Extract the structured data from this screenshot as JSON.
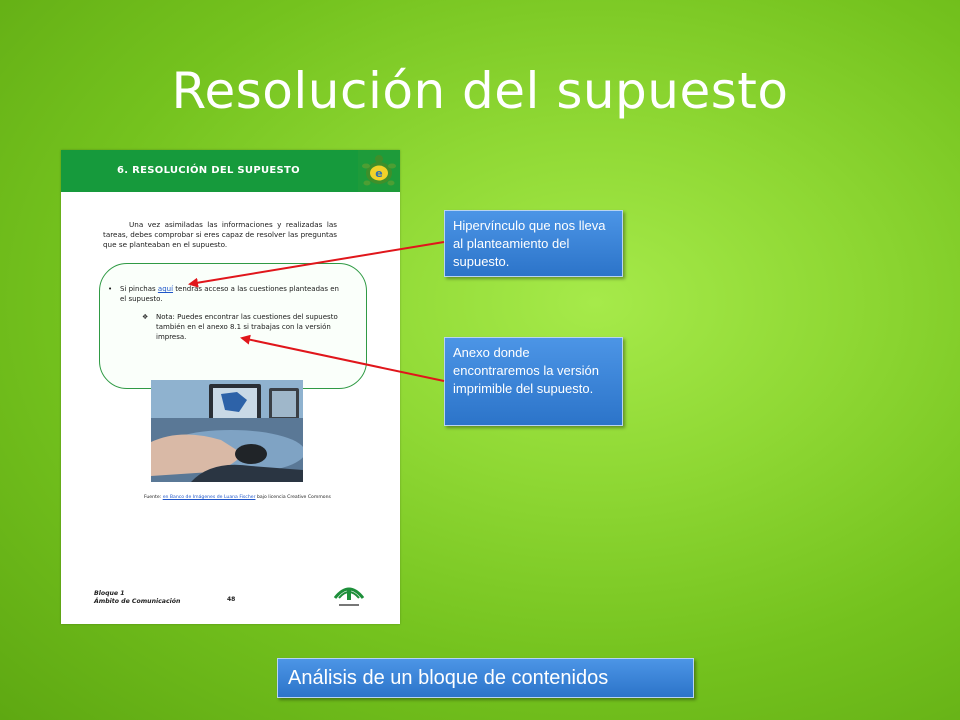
{
  "slide": {
    "title": "Resolución del supuesto",
    "footer_label": "Análisis de un bloque de contenidos"
  },
  "document": {
    "header_title": "6. RESOLUCIÓN DEL SUPUESTO",
    "intro_text": "Una vez asimiladas las informaciones y realizadas las tareas, debes comprobar si eres capaz de resolver las preguntas que se planteaban en el supuesto.",
    "bullet_prefix": "Si pinchas",
    "bullet_link": "aquí",
    "bullet_suffix": "tendrás acceso a las cuestiones planteadas en el supuesto.",
    "note_text": "Nota: Puedes encontrar las cuestiones del supuesto también en el anexo 8.1 si trabajas con la versión impresa.",
    "caption_prefix": "Fuente:",
    "caption_link": "en Banco de Imágenes de Luana Fischer",
    "caption_suffix": "bajo licencia Creative Commons",
    "footer_line1": "Bloque 1",
    "footer_line2": "Ámbito de Comunicación",
    "page_number": "48"
  },
  "callouts": {
    "hyperlink": "Hipervínculo que nos lleva al planteamiento del supuesto.",
    "annex": "Anexo donde encontraremos la versión imprimible del supuesto."
  },
  "colors": {
    "background": "#8fd834",
    "doc_header": "#169a3c",
    "callout": "#2c74c9",
    "arrow": "#e0161b"
  }
}
